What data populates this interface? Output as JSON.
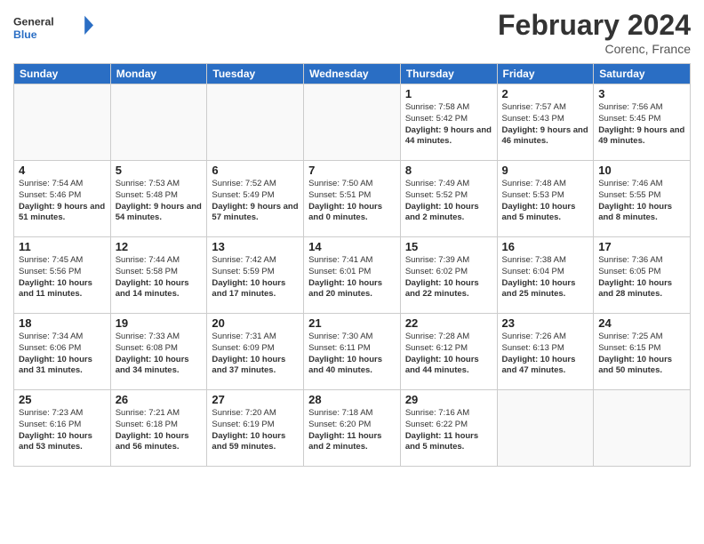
{
  "app": {
    "logo_general": "General",
    "logo_blue": "Blue",
    "month_title": "February 2024",
    "location": "Corenc, France"
  },
  "days_of_week": [
    "Sunday",
    "Monday",
    "Tuesday",
    "Wednesday",
    "Thursday",
    "Friday",
    "Saturday"
  ],
  "weeks": [
    [
      {
        "day": "",
        "info": ""
      },
      {
        "day": "",
        "info": ""
      },
      {
        "day": "",
        "info": ""
      },
      {
        "day": "",
        "info": ""
      },
      {
        "day": "1",
        "sunrise": "7:58 AM",
        "sunset": "5:42 PM",
        "daylight": "9 hours and 44 minutes."
      },
      {
        "day": "2",
        "sunrise": "7:57 AM",
        "sunset": "5:43 PM",
        "daylight": "9 hours and 46 minutes."
      },
      {
        "day": "3",
        "sunrise": "7:56 AM",
        "sunset": "5:45 PM",
        "daylight": "9 hours and 49 minutes."
      }
    ],
    [
      {
        "day": "4",
        "sunrise": "7:54 AM",
        "sunset": "5:46 PM",
        "daylight": "9 hours and 51 minutes."
      },
      {
        "day": "5",
        "sunrise": "7:53 AM",
        "sunset": "5:48 PM",
        "daylight": "9 hours and 54 minutes."
      },
      {
        "day": "6",
        "sunrise": "7:52 AM",
        "sunset": "5:49 PM",
        "daylight": "9 hours and 57 minutes."
      },
      {
        "day": "7",
        "sunrise": "7:50 AM",
        "sunset": "5:51 PM",
        "daylight": "10 hours and 0 minutes."
      },
      {
        "day": "8",
        "sunrise": "7:49 AM",
        "sunset": "5:52 PM",
        "daylight": "10 hours and 2 minutes."
      },
      {
        "day": "9",
        "sunrise": "7:48 AM",
        "sunset": "5:53 PM",
        "daylight": "10 hours and 5 minutes."
      },
      {
        "day": "10",
        "sunrise": "7:46 AM",
        "sunset": "5:55 PM",
        "daylight": "10 hours and 8 minutes."
      }
    ],
    [
      {
        "day": "11",
        "sunrise": "7:45 AM",
        "sunset": "5:56 PM",
        "daylight": "10 hours and 11 minutes."
      },
      {
        "day": "12",
        "sunrise": "7:44 AM",
        "sunset": "5:58 PM",
        "daylight": "10 hours and 14 minutes."
      },
      {
        "day": "13",
        "sunrise": "7:42 AM",
        "sunset": "5:59 PM",
        "daylight": "10 hours and 17 minutes."
      },
      {
        "day": "14",
        "sunrise": "7:41 AM",
        "sunset": "6:01 PM",
        "daylight": "10 hours and 20 minutes."
      },
      {
        "day": "15",
        "sunrise": "7:39 AM",
        "sunset": "6:02 PM",
        "daylight": "10 hours and 22 minutes."
      },
      {
        "day": "16",
        "sunrise": "7:38 AM",
        "sunset": "6:04 PM",
        "daylight": "10 hours and 25 minutes."
      },
      {
        "day": "17",
        "sunrise": "7:36 AM",
        "sunset": "6:05 PM",
        "daylight": "10 hours and 28 minutes."
      }
    ],
    [
      {
        "day": "18",
        "sunrise": "7:34 AM",
        "sunset": "6:06 PM",
        "daylight": "10 hours and 31 minutes."
      },
      {
        "day": "19",
        "sunrise": "7:33 AM",
        "sunset": "6:08 PM",
        "daylight": "10 hours and 34 minutes."
      },
      {
        "day": "20",
        "sunrise": "7:31 AM",
        "sunset": "6:09 PM",
        "daylight": "10 hours and 37 minutes."
      },
      {
        "day": "21",
        "sunrise": "7:30 AM",
        "sunset": "6:11 PM",
        "daylight": "10 hours and 40 minutes."
      },
      {
        "day": "22",
        "sunrise": "7:28 AM",
        "sunset": "6:12 PM",
        "daylight": "10 hours and 44 minutes."
      },
      {
        "day": "23",
        "sunrise": "7:26 AM",
        "sunset": "6:13 PM",
        "daylight": "10 hours and 47 minutes."
      },
      {
        "day": "24",
        "sunrise": "7:25 AM",
        "sunset": "6:15 PM",
        "daylight": "10 hours and 50 minutes."
      }
    ],
    [
      {
        "day": "25",
        "sunrise": "7:23 AM",
        "sunset": "6:16 PM",
        "daylight": "10 hours and 53 minutes."
      },
      {
        "day": "26",
        "sunrise": "7:21 AM",
        "sunset": "6:18 PM",
        "daylight": "10 hours and 56 minutes."
      },
      {
        "day": "27",
        "sunrise": "7:20 AM",
        "sunset": "6:19 PM",
        "daylight": "10 hours and 59 minutes."
      },
      {
        "day": "28",
        "sunrise": "7:18 AM",
        "sunset": "6:20 PM",
        "daylight": "11 hours and 2 minutes."
      },
      {
        "day": "29",
        "sunrise": "7:16 AM",
        "sunset": "6:22 PM",
        "daylight": "11 hours and 5 minutes."
      },
      {
        "day": "",
        "info": ""
      },
      {
        "day": "",
        "info": ""
      }
    ]
  ],
  "labels": {
    "sunrise": "Sunrise:",
    "sunset": "Sunset:",
    "daylight": "Daylight:"
  }
}
